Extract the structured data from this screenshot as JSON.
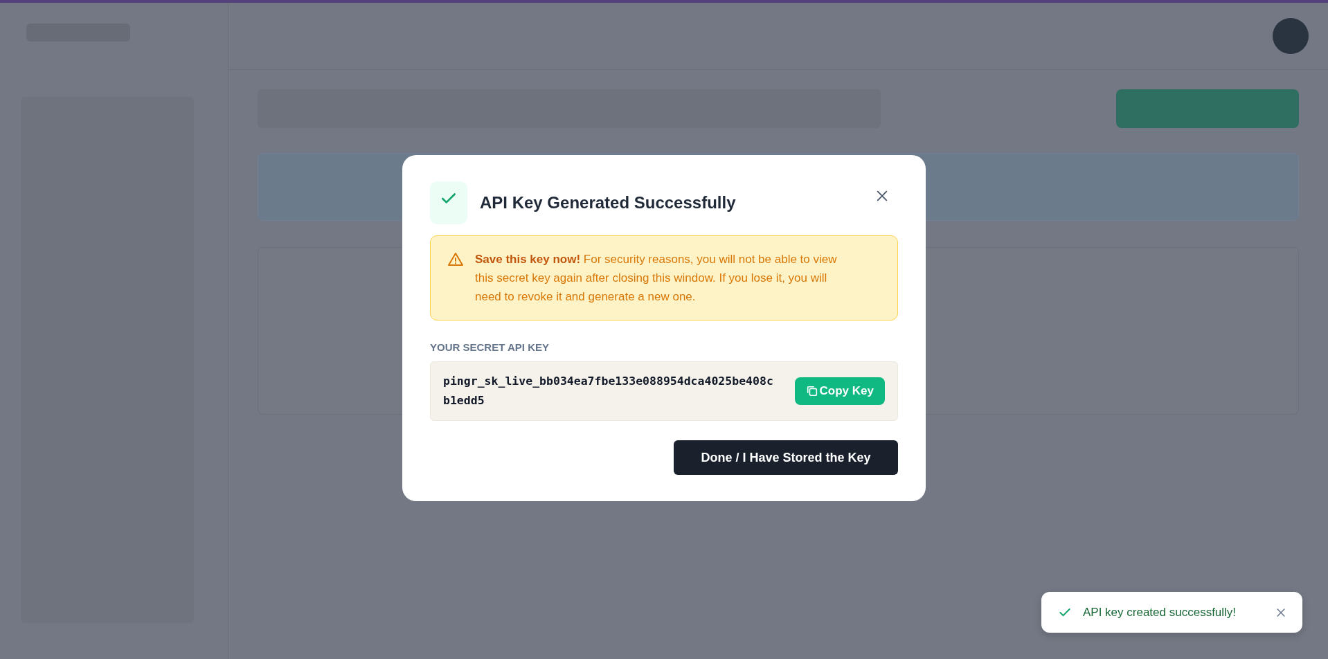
{
  "modal": {
    "title": "API Key Generated Successfully",
    "warning": "**Save this key now!** For security reasons, you will not be able to view this secret key again after closing this window. If you lose it, you will need to revoke it and generate a new one.",
    "key_label": "YOUR SECRET API KEY",
    "key": "pingr_sk_live_bb034ea7fbe133e088954dca4025be408cb1edd5",
    "copy_button": "Copy Key",
    "done_button": "Done / I Have Stored the Key"
  },
  "toast": {
    "message": "API key created successfully!"
  }
}
